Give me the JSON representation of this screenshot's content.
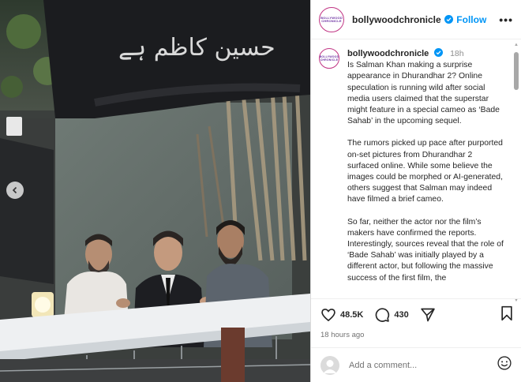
{
  "post": {
    "username": "bollywoodchronicle",
    "follow_label": "Follow",
    "more_label": "•••",
    "avatar_text": "BOLLYWOOD CHRONICLE",
    "time_short": "18h",
    "caption_paragraphs": [
      "Is Salman Khan making a surprise appearance in Dhurandhar 2? Online speculation is running wild after social media users claimed that the superstar might feature in a special cameo as ‘Bade Sahab’ in the upcoming sequel.",
      "The rumors picked up pace after purported on-set pictures from Dhurandhar 2 surfaced online. While some believe the images could be morphed or AI-generated, others suggest that Salman may indeed have filmed a brief cameo.",
      "So far, neither the actor nor the film’s makers have confirmed the reports. Interestingly, sources reveal that the role of ‘Bade Sahab’ was initially played by a different actor, but following the massive success of the first film, the"
    ],
    "likes": "48.5K",
    "comments": "430",
    "time_ago": "18 hours ago",
    "comment_placeholder": "Add a comment...",
    "banner_text": "حسین کاظم ہے"
  },
  "icons": {
    "verified": "verified-badge-icon",
    "like": "heart-icon",
    "comment": "comment-bubble-icon",
    "share": "paper-plane-icon",
    "save": "bookmark-icon",
    "emoji": "smiley-icon",
    "prev": "chevron-left-icon"
  },
  "colors": {
    "accent": "#0095f6",
    "verified": "#0095f6",
    "text": "#262626",
    "muted": "#737373"
  }
}
